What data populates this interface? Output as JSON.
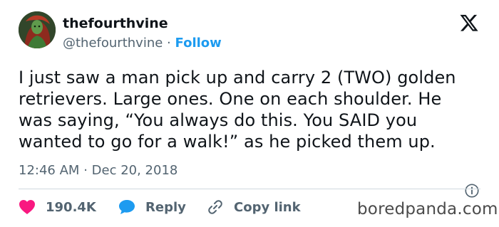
{
  "author": {
    "display_name": "thefourthvine",
    "handle": "@thefourthvine",
    "separator": "·",
    "follow_label": "Follow"
  },
  "tweet": {
    "text": "I just saw a man pick up and carry 2 (TWO) golden\nretrievers. Large ones. One on each shoulder. He\nwas saying, “You always do this. You SAID you\nwanted to go for a walk!” as he picked them up.",
    "time": "12:46 AM",
    "meta_separator": "·",
    "date": "Dec 20, 2018"
  },
  "actions": {
    "like_count": "190.4K",
    "reply_label": "Reply",
    "copy_link_label": "Copy link"
  },
  "icons": {
    "platform": "x-logo-icon",
    "info": "info-icon",
    "like": "heart-icon",
    "reply": "speech-bubble-icon",
    "copy": "link-icon"
  },
  "colors": {
    "accent": "#1d9bf0",
    "like": "#f91880",
    "muted_text": "#536471",
    "body_text": "#0f1419",
    "divider": "#cfd9de"
  },
  "watermark": "boredpanda.com"
}
